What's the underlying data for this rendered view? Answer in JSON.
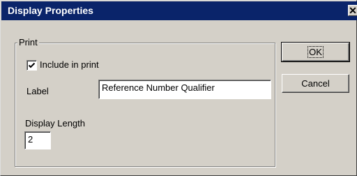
{
  "dialog": {
    "title": "Display Properties",
    "close_glyph": "✕"
  },
  "print_group": {
    "label": "Print",
    "include_in_print": {
      "label": "Include in print",
      "checked": true
    },
    "label_field": {
      "label": "Label",
      "value": "Reference Number Qualifier"
    },
    "display_length": {
      "label": "Display Length",
      "value": "2"
    }
  },
  "buttons": {
    "ok": "OK",
    "cancel": "Cancel"
  },
  "icons": {
    "checkbox": "checkmark-icon",
    "close": "close-icon"
  },
  "colors": {
    "titlebar": "#0a246a",
    "face": "#d4d0c8"
  }
}
